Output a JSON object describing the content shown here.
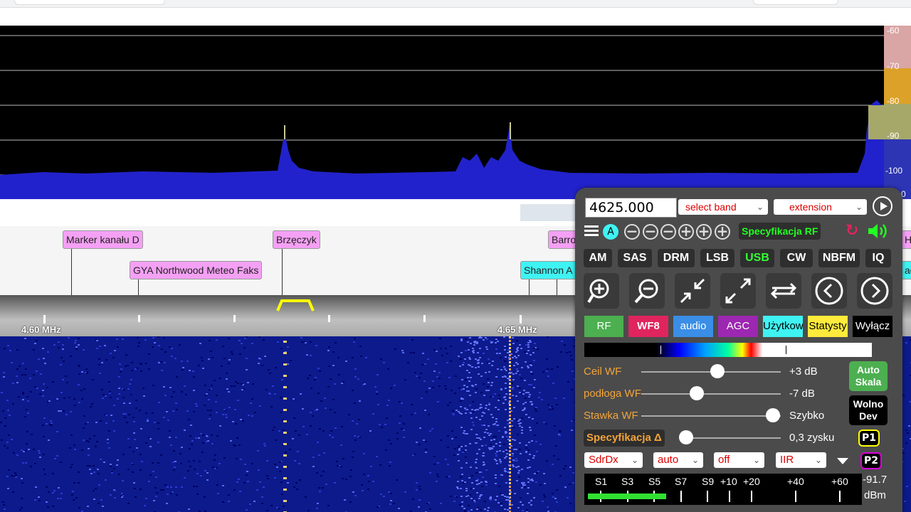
{
  "spectrum": {
    "db_scale": [
      "-60",
      "-70",
      "-80",
      "-90",
      "-100",
      "0"
    ]
  },
  "markers": [
    {
      "text": "Marker kanału D",
      "color": "pink"
    },
    {
      "text": "GYA Northwood Meteo Faks",
      "color": "pink"
    },
    {
      "text": "Brzęczyk",
      "color": "pink"
    },
    {
      "text": "Barro",
      "color": "pink"
    },
    {
      "text": "Shannon A",
      "color": "cyan"
    },
    {
      "text": "H",
      "color": "pink"
    },
    {
      "text": "ad",
      "color": "cyan"
    }
  ],
  "scale": {
    "labels": [
      "4.60 MHz",
      "4.65 MHz"
    ]
  },
  "panel": {
    "frequency": "4625.000",
    "band_select": "select band",
    "extension_select": "extension",
    "vfo_badge": "A",
    "spec_rf_label": "Specyfikacja RF",
    "modes": [
      "AM",
      "SAS",
      "DRM",
      "LSB",
      "USB",
      "CW",
      "NBFM",
      "IQ"
    ],
    "active_mode": "USB",
    "tabs": [
      {
        "label": "RF",
        "color": "#4caf50"
      },
      {
        "label": "WF8",
        "color": "#e0245e"
      },
      {
        "label": "audio",
        "color": "#3a8ee6"
      },
      {
        "label": "AGC",
        "color": "#9c27b0"
      },
      {
        "label": "Użytkow",
        "color": "#3ff3f3"
      },
      {
        "label": "Statysty",
        "color": "#ffeb3b"
      },
      {
        "label": "Wyłącz",
        "color": "#000000"
      }
    ],
    "ceil_wf_label": "Ceil WF",
    "ceil_wf_value": "+3 dB",
    "floor_wf_label": "podłoga WF",
    "floor_wf_value": "-7 dB",
    "rate_wf_label": "Stawka WF",
    "rate_wf_value": "Szybko",
    "spec_delta_label": "Specyfikacja Δ",
    "spec_delta_value": "0,3 zysku",
    "auto_scale_label_1": "Auto",
    "auto_scale_label_2": "Skala",
    "slow_dev_label_1": "Wolno",
    "slow_dev_label_2": "Dev",
    "p1_label": "P1",
    "p2_label": "P2",
    "bottom_selects": [
      "SdrDx",
      "auto",
      "off",
      "IIR"
    ],
    "smeter_labels": [
      "S1",
      "S3",
      "S5",
      "S7",
      "S9",
      "+10",
      "+20",
      "+40",
      "+60"
    ],
    "smeter_level_fraction": 0.29,
    "dbm_value": "-91.7",
    "dbm_unit": "dBm"
  }
}
